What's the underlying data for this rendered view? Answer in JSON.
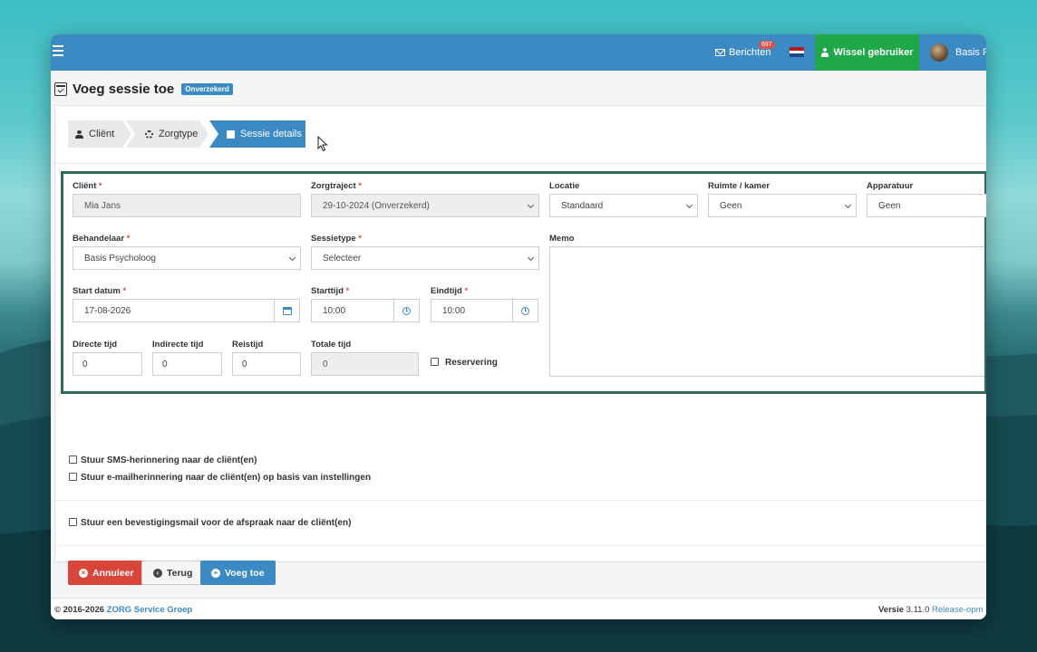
{
  "topbar": {
    "messages_label": "Berichten",
    "messages_count": "697",
    "switch_user_label": "Wissel gebruiker",
    "user_name": "Basis Ps"
  },
  "page": {
    "title": "Voeg sessie toe",
    "badge": "Onverzekerd"
  },
  "wizard": {
    "steps": [
      {
        "label": "Cliënt"
      },
      {
        "label": "Zorgtype"
      },
      {
        "label": "Sessie details"
      }
    ]
  },
  "form": {
    "client": {
      "label": "Cliënt",
      "value": "Mia Jans"
    },
    "zorgtraject": {
      "label": "Zorgtraject",
      "value": "29-10-2024 (Onverzekerd)"
    },
    "locatie": {
      "label": "Locatie",
      "value": "Standaard"
    },
    "ruimte": {
      "label": "Ruimte / kamer",
      "value": "Geen"
    },
    "apparatuur": {
      "label": "Apparatuur",
      "value": "Geen"
    },
    "behandelaar": {
      "label": "Behandelaar",
      "value": "Basis Psycholoog"
    },
    "sessietype": {
      "label": "Sessietype",
      "value": "Selecteer"
    },
    "memo": {
      "label": "Memo",
      "value": ""
    },
    "start_datum": {
      "label": "Start datum",
      "value": "17-08-2026"
    },
    "starttijd": {
      "label": "Starttijd",
      "value": "10:00"
    },
    "eindtijd": {
      "label": "Eindtijd",
      "value": "10:00"
    },
    "directe_tijd": {
      "label": "Directe tijd",
      "value": "0"
    },
    "indirecte_tijd": {
      "label": "Indirecte tijd",
      "value": "0"
    },
    "reistijd": {
      "label": "Reistijd",
      "value": "0"
    },
    "totale_tijd": {
      "label": "Totale tijd",
      "value": "0"
    },
    "reservering": {
      "label": "Reservering"
    },
    "required_mark": "*"
  },
  "options": {
    "sms": "Stuur SMS-herinnering naar de cliënt(en)",
    "email": "Stuur e-mailherinnering naar de cliënt(en) op basis van instellingen",
    "confirm": "Stuur een bevestigingsmail voor de afspraak naar de cliënt(en)"
  },
  "buttons": {
    "cancel": "Annuleer",
    "back": "Terug",
    "add": "Voeg toe"
  },
  "footer": {
    "copyright": "© 2016-2026",
    "brand": "ZORG Service Groep",
    "version_label": "Versie",
    "version": "3.11.0",
    "release": "Release-opm"
  },
  "colors": {
    "primary": "#3b8ac4",
    "success": "#1ea84a",
    "danger": "#d7453b",
    "frame": "#2f6b55"
  }
}
